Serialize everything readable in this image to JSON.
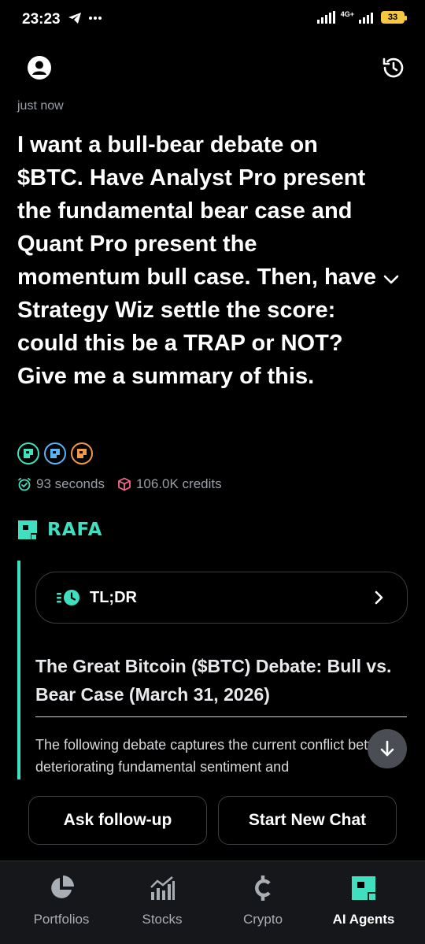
{
  "status_bar": {
    "time": "23:23",
    "battery": "33",
    "network": "4G+"
  },
  "timestamp": "just now",
  "prompt": "I want a bull-bear debate on $BTC. Have Analyst Pro present the fundamental bear case and Quant Pro present the momentum bull case. Then, have Strategy Wiz settle the score: could this be a TRAP or NOT? Give me a summary of this.",
  "agents": [
    {
      "icon": "analyst-pro-icon",
      "color": "#3ee0c0"
    },
    {
      "icon": "quant-pro-icon",
      "color": "#5ab3f5"
    },
    {
      "icon": "strategy-wiz-icon",
      "color": "#f2994a"
    }
  ],
  "stats": {
    "duration": "93 seconds",
    "credits": "106.0K credits"
  },
  "assistant": {
    "name": "RAFA",
    "tldr_label": "TL;DR",
    "report_title": "The Great Bitcoin ($BTC) Debate: Bull vs. Bear Case (March 31, 2026)",
    "report_body": "The following debate captures the current conflict between deteriorating fundamental sentiment and"
  },
  "actions": {
    "follow_up": "Ask follow-up",
    "new_chat": "Start New Chat"
  },
  "nav": {
    "items": [
      {
        "label": "Portfolios",
        "icon": "pie-chart-icon"
      },
      {
        "label": "Stocks",
        "icon": "bar-chart-icon"
      },
      {
        "label": "Crypto",
        "icon": "cent-icon"
      },
      {
        "label": "AI Agents",
        "icon": "ai-agents-icon",
        "active": true
      }
    ]
  },
  "colors": {
    "accent": "#3ee0c0",
    "background": "#000000",
    "muted_text": "#9a9fa7"
  }
}
